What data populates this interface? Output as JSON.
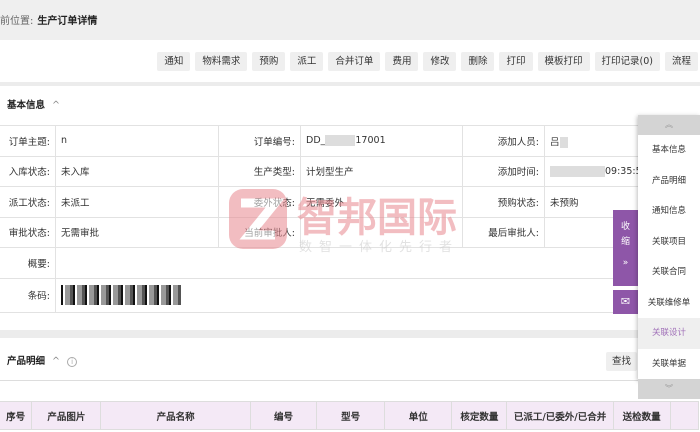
{
  "breadcrumb": {
    "label": "前位置:",
    "current": "生产订单详情"
  },
  "toolbar": [
    "通知",
    "物料需求",
    "预购",
    "派工",
    "合并订单",
    "费用",
    "修改",
    "删除",
    "打印",
    "模板打印",
    "打印记录(0)",
    "流程"
  ],
  "basic": {
    "title": "基本信息",
    "rows": [
      [
        {
          "l": "订单主题:",
          "v": "n"
        },
        {
          "l": "订单编号:",
          "v": "DD_",
          "v2": "17001"
        },
        {
          "l": "添加人员:",
          "v": "吕"
        }
      ],
      [
        {
          "l": "入库状态:",
          "v": "未入库"
        },
        {
          "l": "生产类型:",
          "v": "计划型生产"
        },
        {
          "l": "添加时间:",
          "v": "",
          "v2": "09:35:5"
        }
      ],
      [
        {
          "l": "派工状态:",
          "v": "未派工"
        },
        {
          "l": "委外状态:",
          "v": "无需委外"
        },
        {
          "l": "预购状态:",
          "v": "未预购"
        }
      ],
      [
        {
          "l": "审批状态:",
          "v": "无需审批"
        },
        {
          "l": "当前审批人:",
          "v": ""
        },
        {
          "l": "最后审批人:",
          "v": ""
        }
      ]
    ],
    "summary_label": "概要:",
    "barcode_label": "条码:"
  },
  "product": {
    "title": "产品明细",
    "find": "查找",
    "columns": [
      "序号",
      "产品图片",
      "产品名称",
      "编号",
      "型号",
      "单位",
      "核定数量",
      "已派工/已委外/已合并",
      "送检数量"
    ]
  },
  "side": {
    "items": [
      "基本信息",
      "产品明细",
      "通知信息",
      "关联项目",
      "关联合同",
      "关联维修单",
      "关联设计",
      "关联单据"
    ],
    "active": "关联设计",
    "collapse": "收缩"
  },
  "watermark": {
    "name": "智邦国际",
    "slogan": "数智一体化先行者"
  },
  "colors": {
    "accent": "#8e56a8",
    "header_bg": "#f4e9f6",
    "watermark": "#e8888f"
  }
}
